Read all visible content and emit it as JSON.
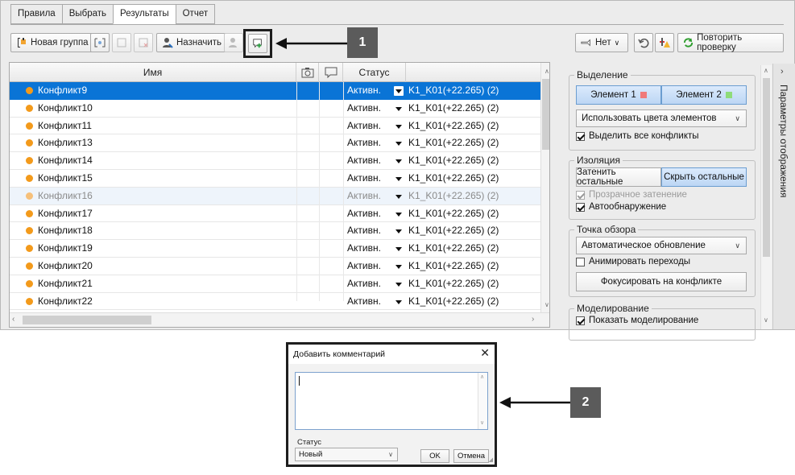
{
  "tabs": [
    "Правила",
    "Выбрать",
    "Результаты",
    "Отчет"
  ],
  "toolbar": {
    "new_group": "Новая группа",
    "assign": "Назначить",
    "none_label": "Нет",
    "repeat_check": "Повторить проверку"
  },
  "grid": {
    "headers": {
      "name": "Имя",
      "status": "Статус"
    },
    "rows": [
      {
        "name": "Конфликт9",
        "status": "Активн.",
        "result": "K1_K01(+22.265) (2)",
        "state": "selected"
      },
      {
        "name": "Конфликт10",
        "status": "Активн.",
        "result": "K1_K01(+22.265) (2)",
        "state": ""
      },
      {
        "name": "Конфликт11",
        "status": "Активн.",
        "result": "K1_K01(+22.265) (2)",
        "state": ""
      },
      {
        "name": "Конфликт13",
        "status": "Активн.",
        "result": "K1_K01(+22.265) (2)",
        "state": ""
      },
      {
        "name": "Конфликт14",
        "status": "Активн.",
        "result": "K1_K01(+22.265) (2)",
        "state": ""
      },
      {
        "name": "Конфликт15",
        "status": "Активн.",
        "result": "K1_K01(+22.265) (2)",
        "state": ""
      },
      {
        "name": "Конфликт16",
        "status": "Активн.",
        "result": "K1_K01(+22.265) (2)",
        "state": "hover"
      },
      {
        "name": "Конфликт17",
        "status": "Активн.",
        "result": "K1_K01(+22.265) (2)",
        "state": ""
      },
      {
        "name": "Конфликт18",
        "status": "Активн.",
        "result": "K1_K01(+22.265) (2)",
        "state": ""
      },
      {
        "name": "Конфликт19",
        "status": "Активн.",
        "result": "K1_K01(+22.265) (2)",
        "state": ""
      },
      {
        "name": "Конфликт20",
        "status": "Активн.",
        "result": "K1_K01(+22.265) (2)",
        "state": ""
      },
      {
        "name": "Конфликт21",
        "status": "Активн.",
        "result": "K1_K01(+22.265) (2)",
        "state": ""
      },
      {
        "name": "Конфликт22",
        "status": "Активн.",
        "result": "K1_K01(+22.265) (2)",
        "state": ""
      }
    ]
  },
  "side": {
    "selection_title": "Выделение",
    "element1": "Элемент 1",
    "element2": "Элемент 2",
    "element1_color": "#f07a7a",
    "element2_color": "#8fdc7a",
    "use_colors": "Использовать цвета элементов",
    "highlight_all": "Выделить все конфликты",
    "isolation_title": "Изоляция",
    "dim_others": "Затенить остальные",
    "hide_others": "Скрыть остальные",
    "transparent_dim": "Прозрачное затенение",
    "auto_reveal": "Автообнаружение",
    "viewpoint_title": "Точка обзора",
    "auto_update": "Автоматическое обновление",
    "animate": "Анимировать переходы",
    "focus": "Фокусировать на конфликте",
    "simulation_title": "Моделирование",
    "show_simulation": "Показать моделирование"
  },
  "strip_label": "Параметры отображения",
  "callouts": {
    "one": "1",
    "two": "2"
  },
  "dialog": {
    "title": "Добавить комментарий",
    "status_label": "Статус",
    "status_value": "Новый",
    "ok": "OK",
    "cancel": "Отмена"
  },
  "colors": {
    "selected_row": "#0a74d6",
    "conflict_dot": "#f39a1b",
    "callout": "#5b5b5b"
  }
}
